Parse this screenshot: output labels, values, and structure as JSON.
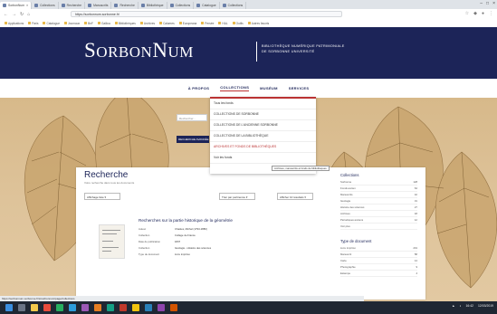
{
  "browser": {
    "tabs": [
      {
        "label": "SorbonNum",
        "active": true
      },
      {
        "label": "Collections"
      },
      {
        "label": "Recherche"
      },
      {
        "label": "Manuscrits"
      },
      {
        "label": "Recherche"
      },
      {
        "label": "Bibliothèque"
      },
      {
        "label": "Collections"
      },
      {
        "label": "Catalogue"
      },
      {
        "label": "Collections"
      }
    ],
    "url": "https://sorbonnum.sorbonne.fr/",
    "bookmarks": [
      "Applications",
      "Paris",
      "Catalogue",
      "Journaux",
      "BnF",
      "Gallica",
      "Bibliothèques",
      "Archives",
      "Calames",
      "Europeana",
      "Persée",
      "HAL",
      "Outils",
      "Autres favoris"
    ]
  },
  "site": {
    "logo_main": "S",
    "logo_rest1": "ORBON",
    "logo_n": "N",
    "logo_rest2": "UM",
    "tagline1": "BIBLIOTHÈQUE NUMÉRIQUE PATRIMONIALE",
    "tagline2": "DE SORBONNE UNIVERSITÉ",
    "nav": [
      "À PROPOS",
      "COLLECTIONS",
      "MUSÉUM",
      "SERVICES"
    ],
    "dropdown": [
      "Tous les fonds",
      "COLLECTIONS DE SORBONNE",
      "COLLECTIONS DE L'ANCIENNE SORBONNE",
      "COLLECTIONS DE LA BIBLIOTHÈQUE",
      "ARCHIVES ET FONDS DE BIBLIOTHÈQUES",
      "Voir les fonds"
    ],
    "tooltip": "Archives, manuscrits et fonds de bibliothèques",
    "search_placeholder": "Rechercher...",
    "advanced_button": "RECHERCHE AVANCÉE"
  },
  "results": {
    "title": "Recherche",
    "subtitle": "Votre recherche dans tous les documents",
    "sort_label": "Trier par pertinence",
    "per_page_label": "Afficher 10 résultats",
    "view_label": "Affichage liste",
    "item": {
      "title": "Recherches sur la partie historique de la géométrie",
      "fields": [
        {
          "k": "Auteur",
          "v": "Chasles, Michel (1793-1880)"
        },
        {
          "k": "Collection",
          "v": "Collège de France"
        },
        {
          "k": "Date de publication",
          "v": "1837"
        },
        {
          "k": "Collection",
          "v": "Géologie - Histoire des sciences"
        },
        {
          "k": "Type de document",
          "v": "Livre imprimé"
        }
      ]
    },
    "facets": {
      "collections_title": "Collections",
      "collections": [
        {
          "label": "Sorbonne",
          "count": "128"
        },
        {
          "label": "Fonds ancien",
          "count": "64"
        },
        {
          "label": "Manuscrits",
          "count": "42"
        },
        {
          "label": "Géologie",
          "count": "31"
        },
        {
          "label": "Histoire des sciences",
          "count": "27"
        },
        {
          "label": "Archives",
          "count": "18"
        },
        {
          "label": "Périodiques anciens",
          "count": "12"
        },
        {
          "label": "Voir plus",
          "count": ""
        }
      ],
      "types_title": "Type de document",
      "types": [
        {
          "label": "Livre imprimé",
          "count": "201"
        },
        {
          "label": "Manuscrit",
          "count": "58"
        },
        {
          "label": "Carte",
          "count": "14"
        },
        {
          "label": "Photographie",
          "count": "9"
        },
        {
          "label": "Estampe",
          "count": "4"
        }
      ]
    }
  },
  "statusbar": "https://sorbonnum.sorbonne.fr/s/sorbonnum/page/collections",
  "taskbar": {
    "time": "16:42",
    "date": "12/03/2019"
  },
  "colors": {
    "header": "#1c2458",
    "accent": "#b33333",
    "hero": "#d7b98a"
  }
}
